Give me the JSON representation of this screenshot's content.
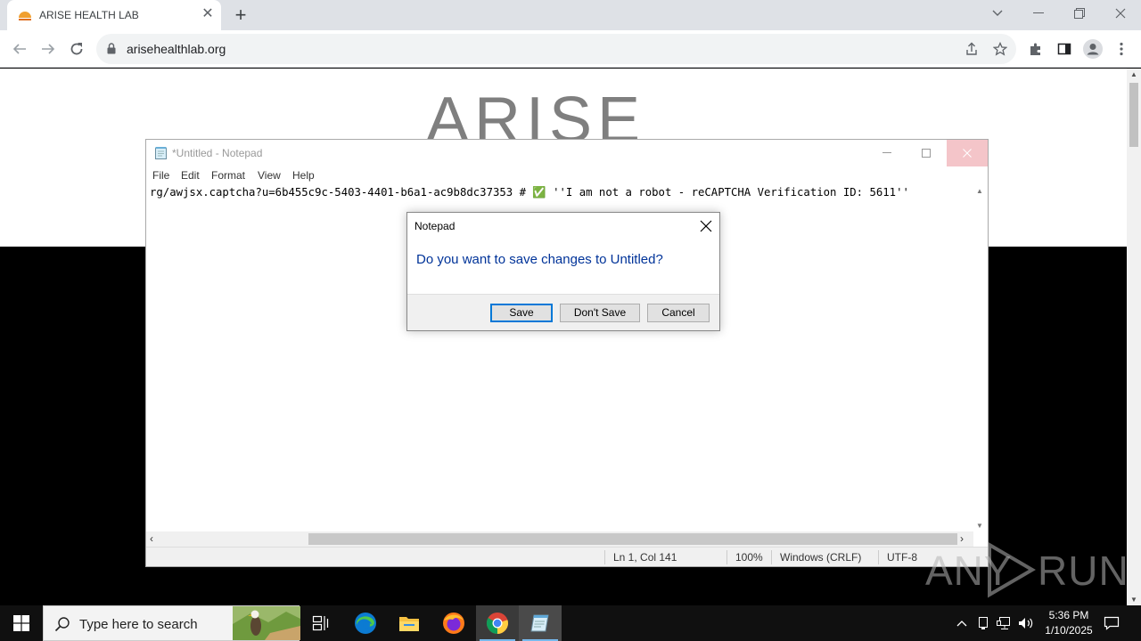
{
  "browser": {
    "tab": {
      "title": "ARISE HEALTH LAB"
    },
    "address_bar": {
      "url": "arisehealthlab.org"
    }
  },
  "page": {
    "logo_text": "ARISE"
  },
  "notepad": {
    "title": "*Untitled - Notepad",
    "menu": [
      "File",
      "Edit",
      "Format",
      "View",
      "Help"
    ],
    "content": "rg/awjsx.captcha?u=6b455c9c-5403-4401-b6a1-ac9b8dc37353 # ✅ ''I am not a robot - reCAPTCHA Verification ID: 5611''",
    "status": {
      "position": "Ln 1, Col 141",
      "zoom": "100%",
      "line_ending": "Windows (CRLF)",
      "encoding": "UTF-8"
    }
  },
  "dialog": {
    "title": "Notepad",
    "message": "Do you want to save changes to Untitled?",
    "buttons": {
      "save": "Save",
      "dont_save": "Don't Save",
      "cancel": "Cancel"
    }
  },
  "watermark": {
    "left": "ANY",
    "right": "RUN"
  },
  "taskbar": {
    "search_placeholder": "Type here to search",
    "apps": [
      "task-view",
      "edge",
      "file-explorer",
      "firefox",
      "chrome",
      "notepad"
    ],
    "clock": {
      "time": "5:36 PM",
      "date": "1/10/2025"
    }
  },
  "colors": {
    "dialog_message": "#003399",
    "save_button_focus": "#0078d7",
    "taskbar": "#101010"
  }
}
